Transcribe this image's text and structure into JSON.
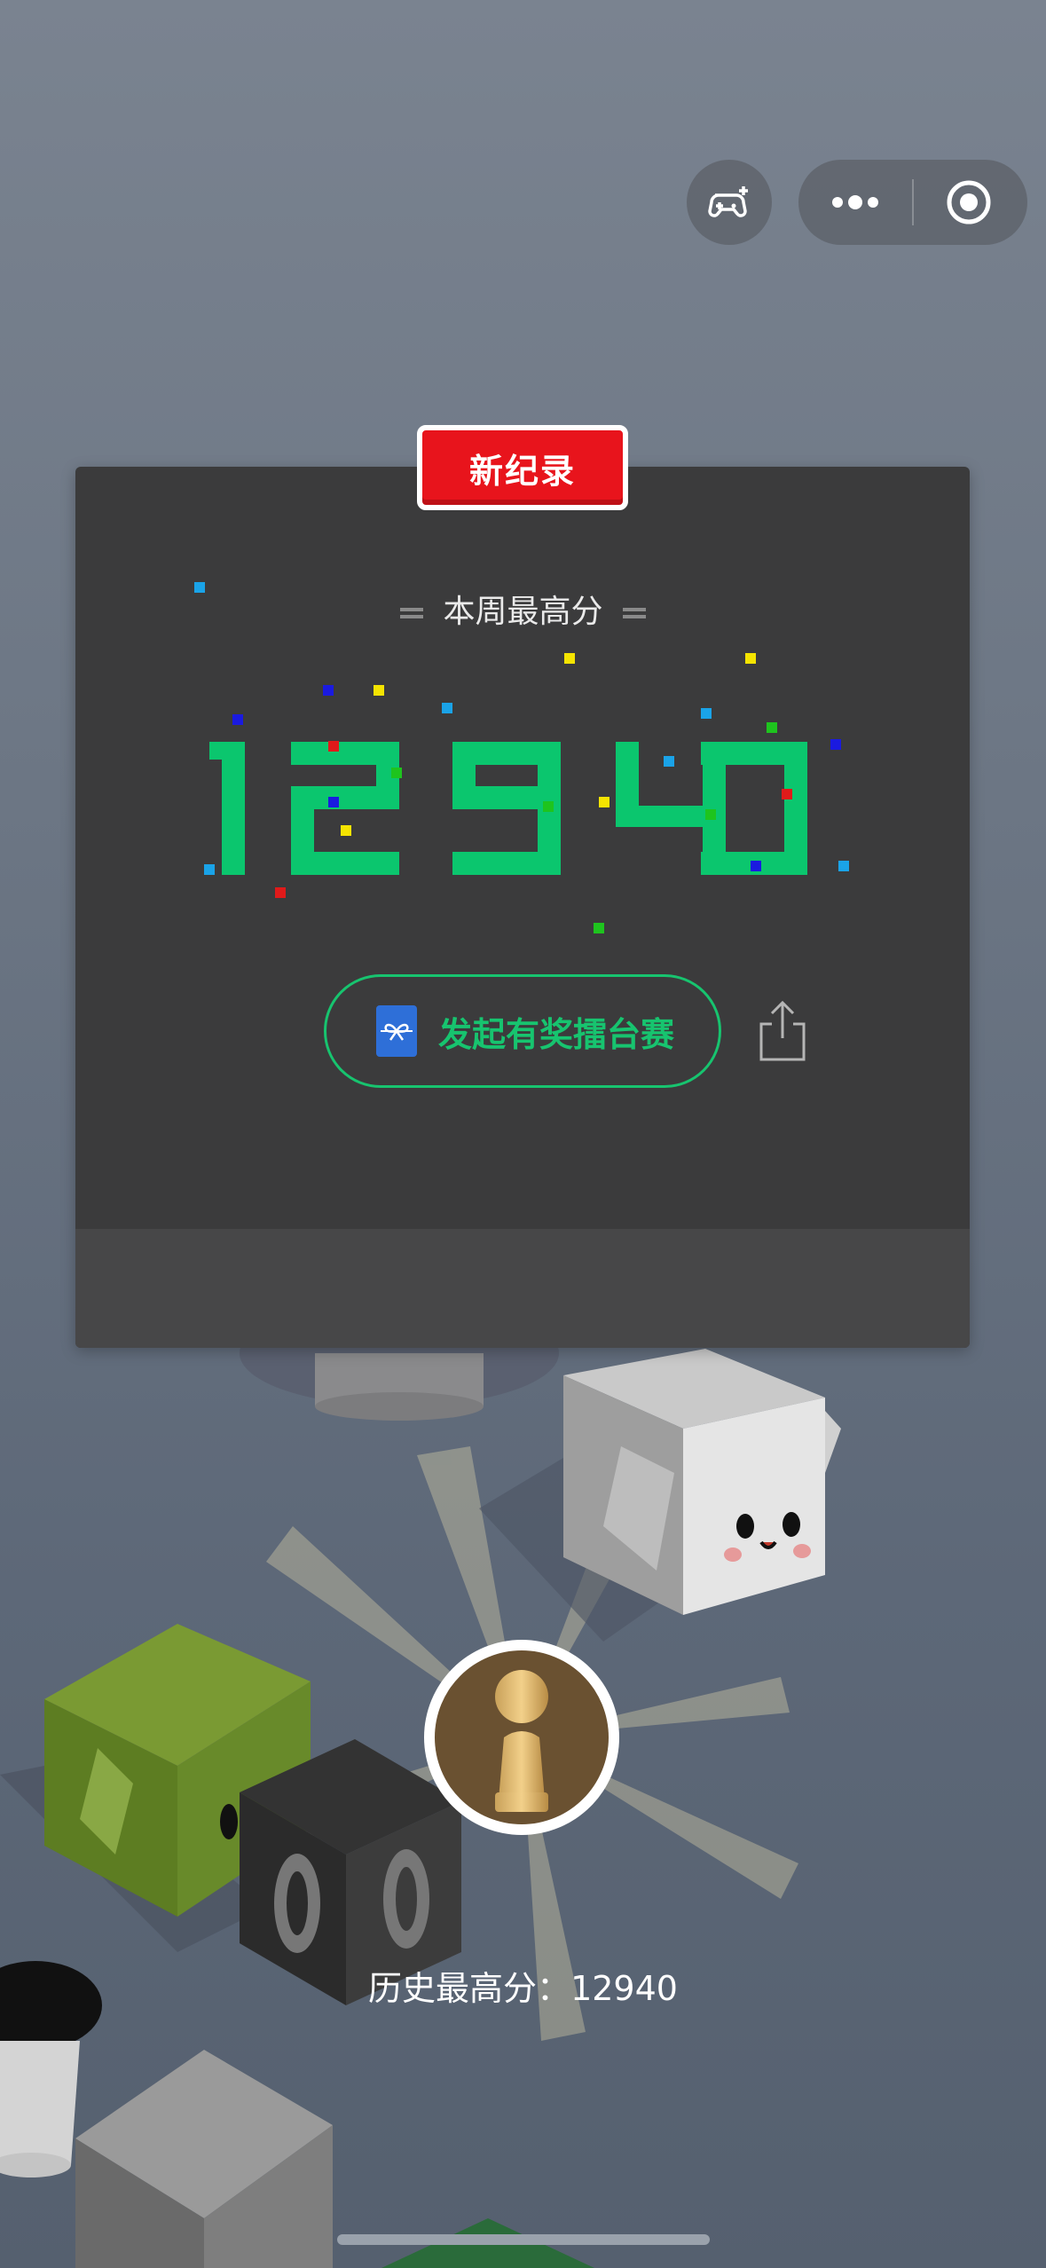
{
  "header": {
    "game_button_icon": "gamepad-plus-icon",
    "more_icon": "more-dots-icon",
    "close_icon": "target-close-icon"
  },
  "card": {
    "record_badge": "新纪录",
    "week_title": "本周最高分",
    "weekly_high_score": "12940",
    "challenge_button": "发起有奖擂台赛",
    "challenge_icon": "gift-icon",
    "share_icon": "share-icon",
    "score_color": "#0bc66e",
    "accent_green": "#17c46f",
    "badge_red": "#e8141c"
  },
  "player": {
    "avatar_icon": "pawn-avatar-icon",
    "history_label": "历史最高分：",
    "history_score": "12940"
  }
}
